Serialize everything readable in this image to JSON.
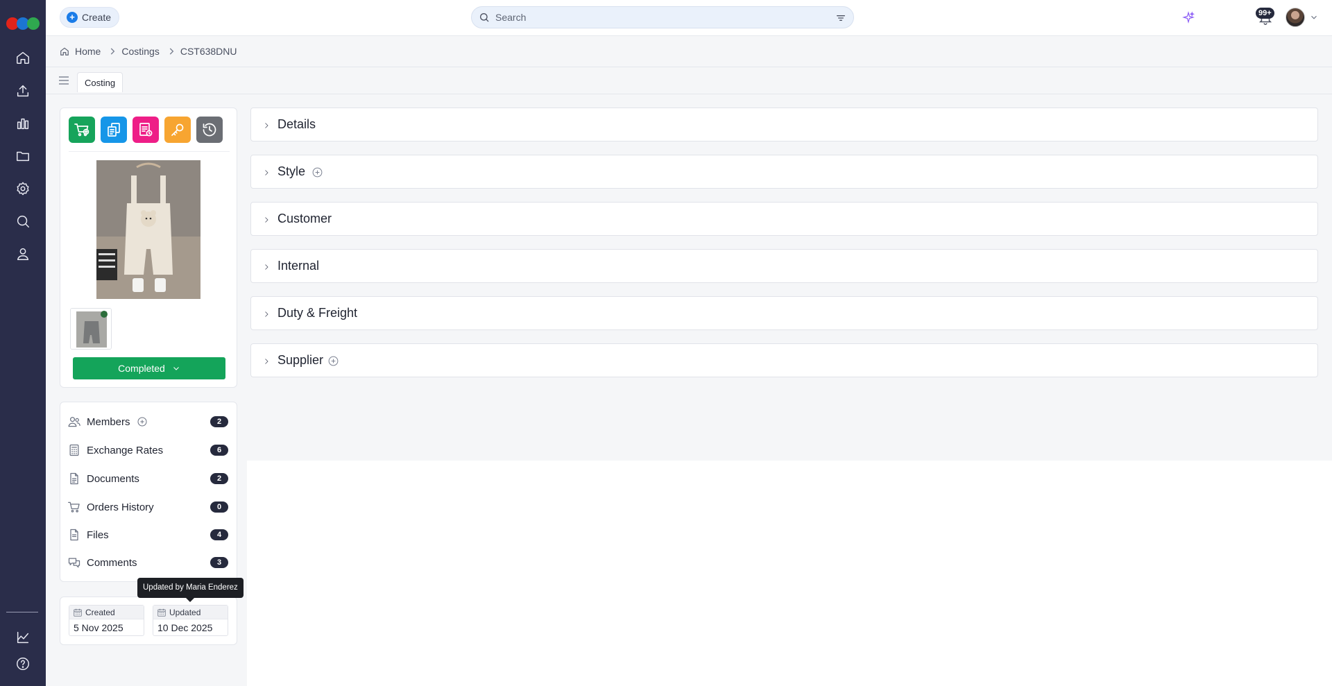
{
  "colors": {
    "rail": "#2a2d4a",
    "status_green": "#14a45a",
    "badge": "#262a3d",
    "quick_actions": [
      "#16a45b",
      "#1696e8",
      "#ee1e87",
      "#f7a531",
      "#6b6e74"
    ]
  },
  "topbar": {
    "create_label": "Create",
    "search_placeholder": "Search",
    "notifications_count": "99+"
  },
  "breadcrumb": {
    "items": [
      "Home",
      "Costings",
      "CST638DNU"
    ]
  },
  "tabs": [
    "Costing"
  ],
  "item": {
    "status": "Completed"
  },
  "quick_actions": [
    "cart-add-icon",
    "copy-documents-icon",
    "report-icon",
    "key-icon",
    "history-icon"
  ],
  "side_nav": [
    {
      "label": "Members",
      "count": "2",
      "icon": "users-icon"
    },
    {
      "label": "Exchange Rates",
      "count": "6",
      "icon": "calculator-icon"
    },
    {
      "label": "Documents",
      "count": "2",
      "icon": "document-icon"
    },
    {
      "label": "Orders History",
      "count": "0",
      "icon": "cart-icon"
    },
    {
      "label": "Files",
      "count": "4",
      "icon": "file-icon"
    },
    {
      "label": "Comments",
      "count": "3",
      "icon": "comments-icon"
    }
  ],
  "dates": {
    "created_label": "Created",
    "created_value": "5 Nov 2025",
    "updated_label": "Updated",
    "updated_value": "10 Dec 2025",
    "tooltip": "Updated by Maria Enderez"
  },
  "sections": [
    {
      "label": "Details"
    },
    {
      "label": "Style"
    },
    {
      "label": "Customer"
    },
    {
      "label": "Internal"
    },
    {
      "label": "Duty & Freight"
    },
    {
      "label": "Supplier"
    }
  ]
}
